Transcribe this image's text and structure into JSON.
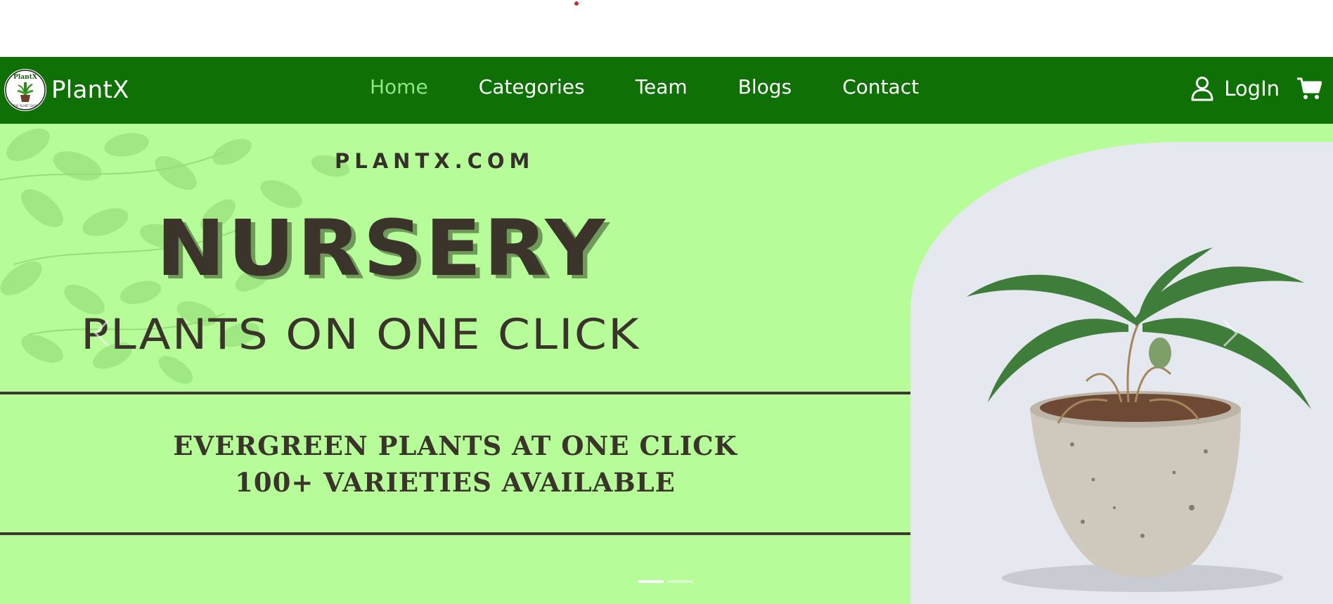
{
  "brand": {
    "name": "PlantX",
    "logo_icon": "plant-logo-icon",
    "logo_text": "PlantX",
    "logo_subtext": "THE PLANT SHOP"
  },
  "nav": {
    "items": [
      {
        "label": "Home",
        "active": true
      },
      {
        "label": "Categories",
        "active": false
      },
      {
        "label": "Team",
        "active": false
      },
      {
        "label": "Blogs",
        "active": false
      },
      {
        "label": "Contact",
        "active": false
      }
    ],
    "login_label": "LogIn",
    "user_icon": "user-icon",
    "cart_icon": "cart-icon"
  },
  "hero": {
    "site": "PLANTX.COM",
    "title": "NURSERY",
    "subtitle": "PLANTS ON ONE CLICK",
    "tagline_1": "EVERGREEN PLANTS AT ONE CLICK",
    "tagline_2": "100+ VARIETIES AVAILABLE",
    "slides_total": 2,
    "active_slide": 1
  },
  "colors": {
    "navbar": "#0f7005",
    "nav_active": "#8de68a",
    "hero_bg": "#b6fd9a",
    "text_dark": "#3b342b",
    "red_dot": "#d9262b"
  }
}
